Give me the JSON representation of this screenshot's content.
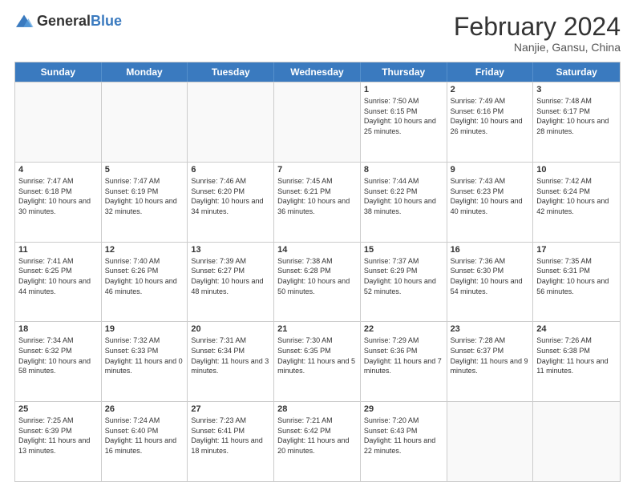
{
  "logo": {
    "general": "General",
    "blue": "Blue"
  },
  "title": "February 2024",
  "subtitle": "Nanjie, Gansu, China",
  "days": [
    "Sunday",
    "Monday",
    "Tuesday",
    "Wednesday",
    "Thursday",
    "Friday",
    "Saturday"
  ],
  "weeks": [
    [
      {
        "day": "",
        "info": ""
      },
      {
        "day": "",
        "info": ""
      },
      {
        "day": "",
        "info": ""
      },
      {
        "day": "",
        "info": ""
      },
      {
        "day": "1",
        "info": "Sunrise: 7:50 AM\nSunset: 6:15 PM\nDaylight: 10 hours and 25 minutes."
      },
      {
        "day": "2",
        "info": "Sunrise: 7:49 AM\nSunset: 6:16 PM\nDaylight: 10 hours and 26 minutes."
      },
      {
        "day": "3",
        "info": "Sunrise: 7:48 AM\nSunset: 6:17 PM\nDaylight: 10 hours and 28 minutes."
      }
    ],
    [
      {
        "day": "4",
        "info": "Sunrise: 7:47 AM\nSunset: 6:18 PM\nDaylight: 10 hours and 30 minutes."
      },
      {
        "day": "5",
        "info": "Sunrise: 7:47 AM\nSunset: 6:19 PM\nDaylight: 10 hours and 32 minutes."
      },
      {
        "day": "6",
        "info": "Sunrise: 7:46 AM\nSunset: 6:20 PM\nDaylight: 10 hours and 34 minutes."
      },
      {
        "day": "7",
        "info": "Sunrise: 7:45 AM\nSunset: 6:21 PM\nDaylight: 10 hours and 36 minutes."
      },
      {
        "day": "8",
        "info": "Sunrise: 7:44 AM\nSunset: 6:22 PM\nDaylight: 10 hours and 38 minutes."
      },
      {
        "day": "9",
        "info": "Sunrise: 7:43 AM\nSunset: 6:23 PM\nDaylight: 10 hours and 40 minutes."
      },
      {
        "day": "10",
        "info": "Sunrise: 7:42 AM\nSunset: 6:24 PM\nDaylight: 10 hours and 42 minutes."
      }
    ],
    [
      {
        "day": "11",
        "info": "Sunrise: 7:41 AM\nSunset: 6:25 PM\nDaylight: 10 hours and 44 minutes."
      },
      {
        "day": "12",
        "info": "Sunrise: 7:40 AM\nSunset: 6:26 PM\nDaylight: 10 hours and 46 minutes."
      },
      {
        "day": "13",
        "info": "Sunrise: 7:39 AM\nSunset: 6:27 PM\nDaylight: 10 hours and 48 minutes."
      },
      {
        "day": "14",
        "info": "Sunrise: 7:38 AM\nSunset: 6:28 PM\nDaylight: 10 hours and 50 minutes."
      },
      {
        "day": "15",
        "info": "Sunrise: 7:37 AM\nSunset: 6:29 PM\nDaylight: 10 hours and 52 minutes."
      },
      {
        "day": "16",
        "info": "Sunrise: 7:36 AM\nSunset: 6:30 PM\nDaylight: 10 hours and 54 minutes."
      },
      {
        "day": "17",
        "info": "Sunrise: 7:35 AM\nSunset: 6:31 PM\nDaylight: 10 hours and 56 minutes."
      }
    ],
    [
      {
        "day": "18",
        "info": "Sunrise: 7:34 AM\nSunset: 6:32 PM\nDaylight: 10 hours and 58 minutes."
      },
      {
        "day": "19",
        "info": "Sunrise: 7:32 AM\nSunset: 6:33 PM\nDaylight: 11 hours and 0 minutes."
      },
      {
        "day": "20",
        "info": "Sunrise: 7:31 AM\nSunset: 6:34 PM\nDaylight: 11 hours and 3 minutes."
      },
      {
        "day": "21",
        "info": "Sunrise: 7:30 AM\nSunset: 6:35 PM\nDaylight: 11 hours and 5 minutes."
      },
      {
        "day": "22",
        "info": "Sunrise: 7:29 AM\nSunset: 6:36 PM\nDaylight: 11 hours and 7 minutes."
      },
      {
        "day": "23",
        "info": "Sunrise: 7:28 AM\nSunset: 6:37 PM\nDaylight: 11 hours and 9 minutes."
      },
      {
        "day": "24",
        "info": "Sunrise: 7:26 AM\nSunset: 6:38 PM\nDaylight: 11 hours and 11 minutes."
      }
    ],
    [
      {
        "day": "25",
        "info": "Sunrise: 7:25 AM\nSunset: 6:39 PM\nDaylight: 11 hours and 13 minutes."
      },
      {
        "day": "26",
        "info": "Sunrise: 7:24 AM\nSunset: 6:40 PM\nDaylight: 11 hours and 16 minutes."
      },
      {
        "day": "27",
        "info": "Sunrise: 7:23 AM\nSunset: 6:41 PM\nDaylight: 11 hours and 18 minutes."
      },
      {
        "day": "28",
        "info": "Sunrise: 7:21 AM\nSunset: 6:42 PM\nDaylight: 11 hours and 20 minutes."
      },
      {
        "day": "29",
        "info": "Sunrise: 7:20 AM\nSunset: 6:43 PM\nDaylight: 11 hours and 22 minutes."
      },
      {
        "day": "",
        "info": ""
      },
      {
        "day": "",
        "info": ""
      }
    ]
  ]
}
